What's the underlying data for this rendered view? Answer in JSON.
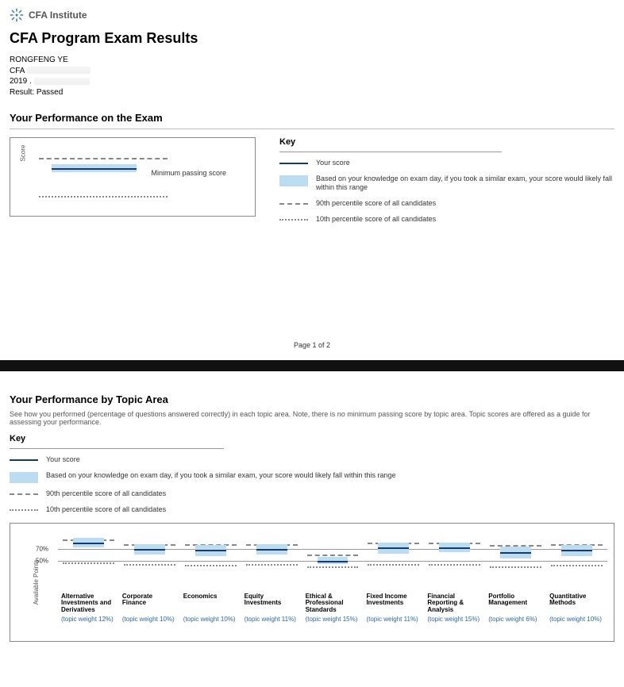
{
  "header": {
    "org": "CFA Institute",
    "title": "CFA Program Exam Results"
  },
  "candidate": {
    "name": "RONGFENG YE",
    "line2_prefix": "CFA",
    "line3_prefix": "2019",
    "result_label": "Result:",
    "result_value": "Passed"
  },
  "performance": {
    "heading": "Your Performance on the Exam",
    "y_axis": "Score",
    "mps_label": "Minimum passing score"
  },
  "key": {
    "title": "Key",
    "your_score": "Your score",
    "band": "Based on your knowledge on exam day, if you took a similar exam, your score would likely fall within this range",
    "p90": "90th percentile score of all candidates",
    "p10": "10th percentile score of all candidates"
  },
  "pager": "Page 1 of 2",
  "topics": {
    "heading": "Your Performance by Topic Area",
    "note": "See how you performed (percentage of questions answered correctly) in each topic area. Note, there is no minimum passing score by topic area. Topic scores are offered as a guide for assessing your performance.",
    "y_axis": "Available Points",
    "tick70": "70%",
    "tick50": "50%"
  },
  "chart_data": {
    "overall": {
      "type": "band",
      "scale_pct": {
        "p90": 82,
        "p10": 18
      },
      "score_pct": 68,
      "band_pct": [
        60,
        74
      ],
      "mps_label": "Minimum passing score"
    },
    "topics_chart": {
      "type": "band-multiples",
      "ylabel": "Available Points",
      "gridlines_pct": [
        70,
        50
      ],
      "series": [
        {
          "name": "Alternative Investments and Derivatives",
          "weight": "(topic weight 12%)",
          "p90": 86,
          "p10": 46,
          "score": 80,
          "band": [
            72,
            88
          ]
        },
        {
          "name": "Corporate Finance",
          "weight": "(topic weight 10%)",
          "p90": 78,
          "p10": 44,
          "score": 70,
          "band": [
            60,
            78
          ]
        },
        {
          "name": "Economics",
          "weight": "(topic weight 10%)",
          "p90": 78,
          "p10": 42,
          "score": 68,
          "band": [
            58,
            76
          ]
        },
        {
          "name": "Equity Investments",
          "weight": "(topic weight 11%)",
          "p90": 78,
          "p10": 44,
          "score": 70,
          "band": [
            60,
            78
          ]
        },
        {
          "name": "Ethical & Professional Standards",
          "weight": "(topic weight 15%)",
          "p90": 60,
          "p10": 40,
          "score": 50,
          "band": [
            44,
            56
          ]
        },
        {
          "name": "Fixed Income Investments",
          "weight": "(topic weight 11%)",
          "p90": 80,
          "p10": 44,
          "score": 72,
          "band": [
            62,
            80
          ]
        },
        {
          "name": "Financial Reporting & Analysis",
          "weight": "(topic weight 15%)",
          "p90": 80,
          "p10": 44,
          "score": 72,
          "band": [
            64,
            80
          ]
        },
        {
          "name": "Portfolio Management",
          "weight": "(topic weight 6%)",
          "p90": 76,
          "p10": 40,
          "score": 64,
          "band": [
            54,
            74
          ]
        },
        {
          "name": "Quantitative Methods",
          "weight": "(topic weight 10%)",
          "p90": 78,
          "p10": 42,
          "score": 68,
          "band": [
            58,
            76
          ]
        }
      ]
    }
  }
}
